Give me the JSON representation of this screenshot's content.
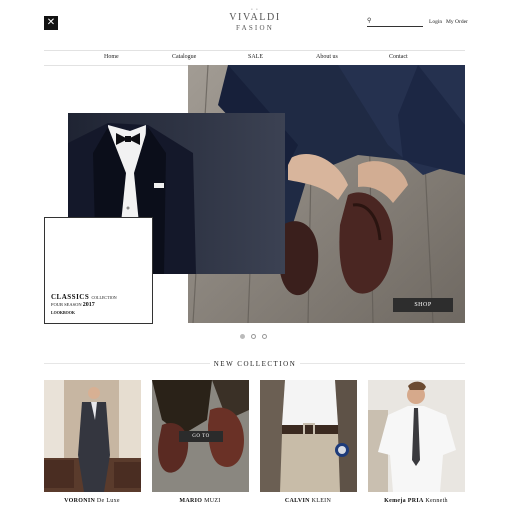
{
  "header": {
    "menu_icon": "close-icon",
    "logo_line1": "VIVALDI",
    "logo_line2": "FASION",
    "search_icon": "search-icon",
    "login": "Login",
    "orders": "My Order"
  },
  "nav": [
    "Home",
    "Catalogue",
    "SALE",
    "About us",
    "Contact"
  ],
  "hero": {
    "collection": "CLASSICS",
    "collection_suffix": "COLLECTION",
    "season_label": "FOUR SEASON",
    "year": "2017",
    "lookbook": "LOOKBOOK",
    "shop_label": "SHOP",
    "slides_count": 3,
    "active_slide": 1
  },
  "new_collection": {
    "title": "NEW COLLECTION",
    "goto_label": "GO TO",
    "products": [
      {
        "name_bold": "VORONIN",
        "name_rest": "De Luxe"
      },
      {
        "name_bold": "MARIO",
        "name_rest": "MUZI"
      },
      {
        "name_bold": "CALVIN",
        "name_rest": "KLEIN"
      },
      {
        "name_bold": "Kemeja PRIA",
        "name_rest": "Kenneth"
      }
    ]
  },
  "colors": {
    "dark": "#2d2d2d",
    "suit_navy": "#2a2f3d",
    "floor_wood": "#8f8a83"
  }
}
